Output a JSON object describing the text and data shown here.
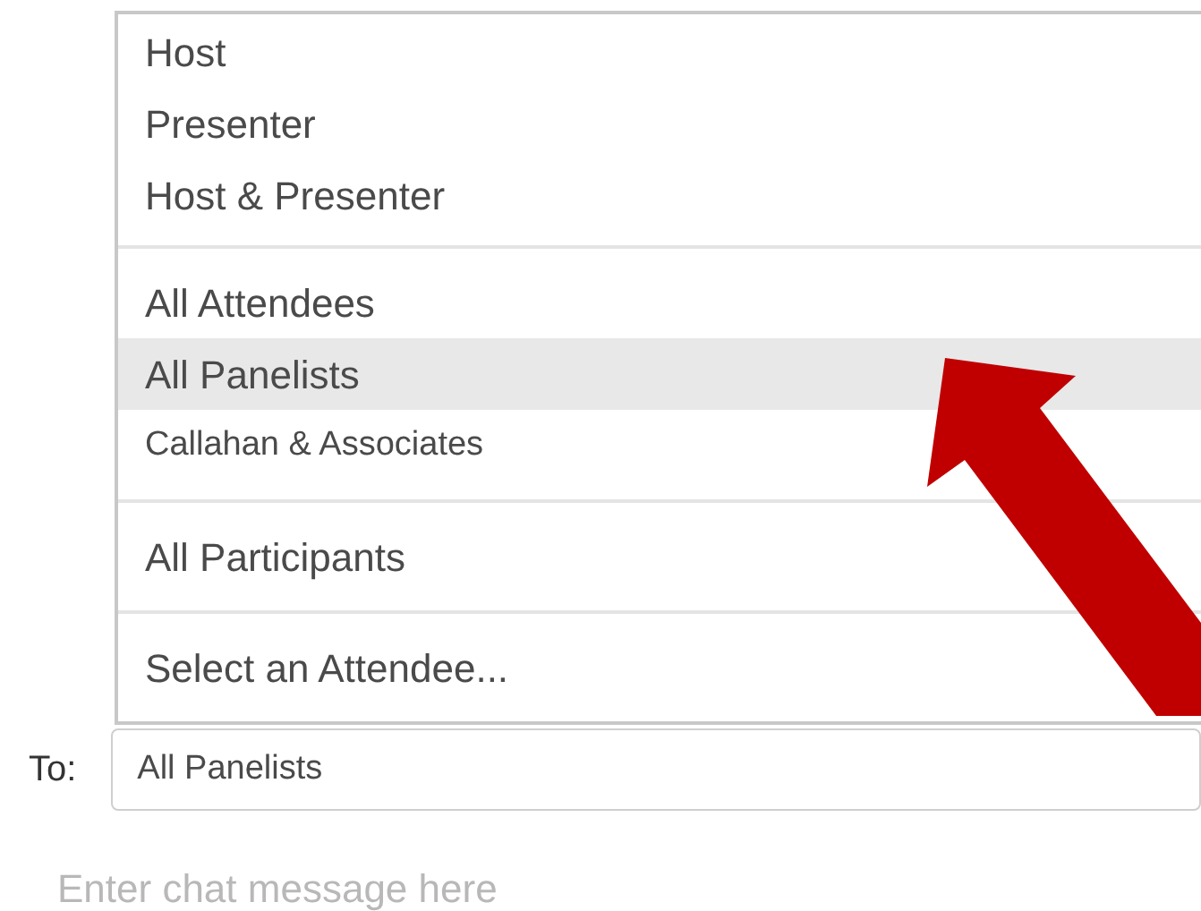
{
  "menu": {
    "groups": [
      {
        "items": [
          {
            "label": "Host",
            "kind": "role",
            "selected": false
          },
          {
            "label": "Presenter",
            "kind": "role",
            "selected": false
          },
          {
            "label": "Host & Presenter",
            "kind": "role",
            "selected": false
          }
        ]
      },
      {
        "items": [
          {
            "label": "All Attendees",
            "kind": "role",
            "selected": false
          },
          {
            "label": "All Panelists",
            "kind": "role",
            "selected": true
          },
          {
            "label": "Callahan & Associates",
            "kind": "team",
            "selected": false
          }
        ]
      },
      {
        "items": [
          {
            "label": "All Participants",
            "kind": "role",
            "selected": false
          }
        ]
      },
      {
        "items": [
          {
            "label": "Select an Attendee...",
            "kind": "role",
            "selected": false
          }
        ]
      }
    ]
  },
  "to_field": {
    "label": "To:",
    "value": "All Panelists"
  },
  "message_field": {
    "placeholder": "Enter chat message here"
  }
}
